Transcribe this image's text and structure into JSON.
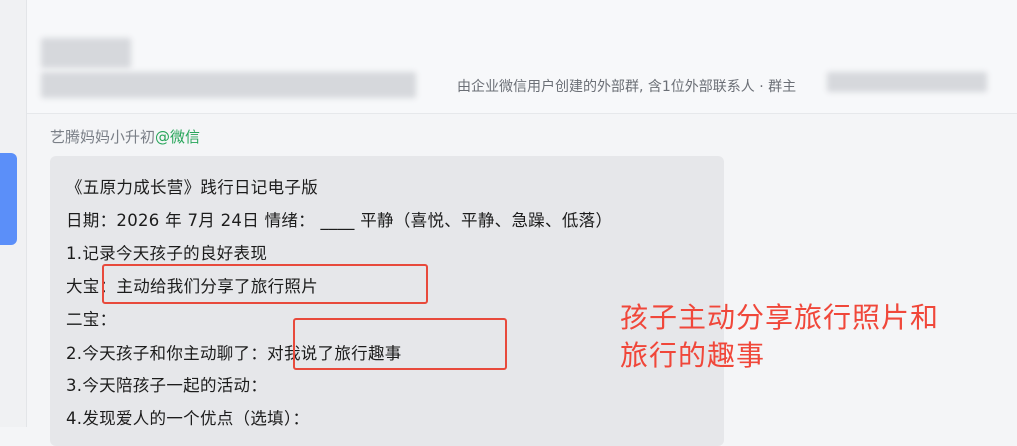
{
  "header": {
    "group_description": "由企业微信用户创建的外部群, 含1位外部联系人 · 群主"
  },
  "message": {
    "sender_name": "艺腾妈妈小升初",
    "sender_source": "@微信",
    "lines": [
      "《五原力成长营》践行日记电子版",
      "日期：2026 年  7月  24日 情绪：  ____ 平静（喜悦、平静、急躁、低落）",
      "1.记录今天孩子的良好表现",
      "大宝：主动给我们分享了旅行照片",
      "二宝：",
      " 2.今天孩子和你主动聊了：对我说了旅行趣事",
      " 3.今天陪孩子一起的活动：",
      " 4.发现爱人的一个优点（选填）："
    ]
  },
  "annotation": {
    "line1": "孩子主动分享旅行照片和",
    "line2": "旅行的趣事",
    "color": "#f0473a"
  }
}
